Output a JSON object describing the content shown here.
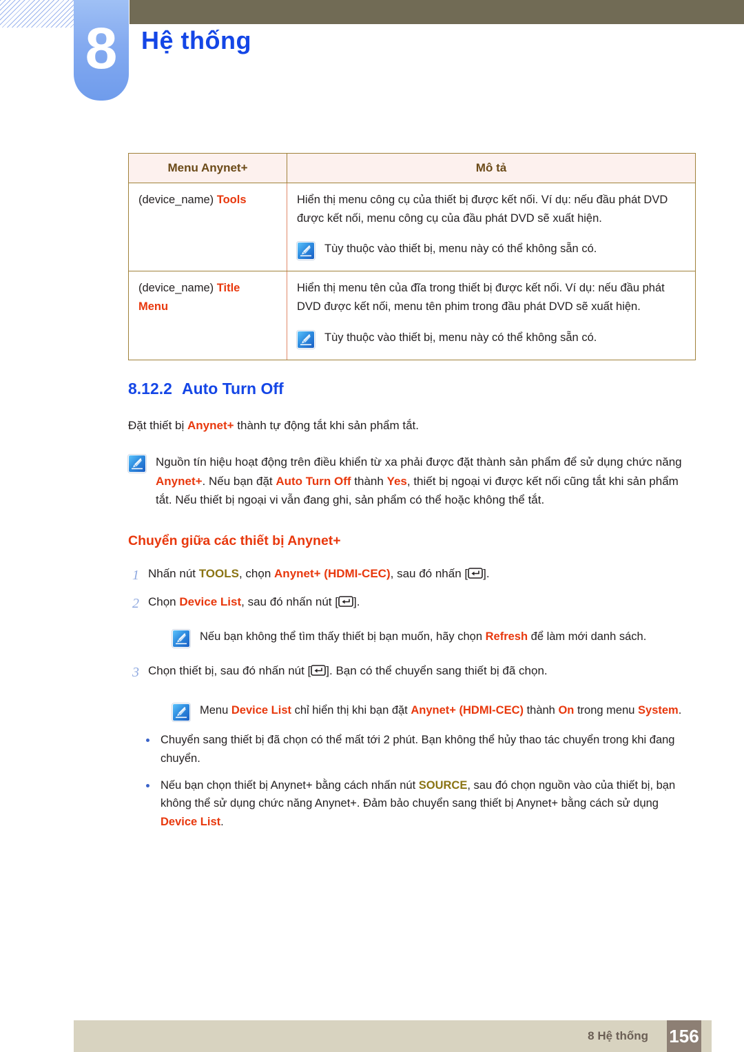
{
  "header": {
    "chapter_number": "8",
    "chapter_title": "Hệ thống"
  },
  "table": {
    "columns": [
      "Menu Anynet+",
      "Mô tả"
    ],
    "rows": [
      {
        "menu_prefix": "(device_name) ",
        "menu_highlight": "Tools",
        "menu_highlight2": "",
        "desc": "Hiển thị menu công cụ của thiết bị được kết nối. Ví dụ: nếu đầu phát DVD được kết nối, menu công cụ của đầu phát DVD sẽ xuất hiện.",
        "note": "Tùy thuộc vào thiết bị, menu này có thể không sẵn có."
      },
      {
        "menu_prefix": "(device_name) ",
        "menu_highlight": "Title",
        "menu_highlight2": "Menu",
        "desc": "Hiển thị menu tên của đĩa trong thiết bị được kết nối. Ví dụ: nếu đầu phát DVD được kết nối, menu tên phim trong đầu phát DVD sẽ xuất hiện.",
        "note": "Tùy thuộc vào thiết bị, menu này có thể không sẵn có."
      }
    ]
  },
  "section": {
    "number": "8.12.2",
    "title": "Auto Turn Off",
    "intro": {
      "part1": "Đặt thiết bị ",
      "hl1": "Anynet+",
      "part2": " thành tự động tắt khi sản phẩm tắt."
    },
    "note": {
      "p1": "Nguồn tín hiệu hoạt động trên điều khiển từ xa phải được đặt thành sản phẩm để sử dụng chức năng ",
      "hl1": "Anynet+",
      "p2": ". Nếu bạn đặt ",
      "hl2": "Auto Turn Off",
      "p3": " thành ",
      "hl3": "Yes",
      "p4": ", thiết bị ngoại vi được kết nối cũng tắt khi sản phẩm tắt. Nếu thiết bị ngoại vi vẫn đang ghi, sản phẩm có thể hoặc không thể tắt."
    }
  },
  "switching": {
    "heading": "Chuyển giữa các thiết bị Anynet+",
    "steps": [
      {
        "num": "1",
        "p1": "Nhấn nút ",
        "hl_olive": "TOOLS",
        "p2": ", chọn ",
        "hl_org": "Anynet+ (HDMI-CEC)",
        "p3": ", sau đó nhấn [",
        "icon": "enter-key-icon",
        "p4": "]."
      },
      {
        "num": "2",
        "p1": "Chọn ",
        "hl_olive": "",
        "p2": "",
        "hl_org": "Device List",
        "p3": ", sau đó nhấn nút [",
        "icon": "enter-key-icon",
        "p4": "]."
      },
      {
        "num": "3",
        "p1": "Chọn thiết bị, sau đó nhấn nút [",
        "hl_olive": "",
        "p2": "",
        "hl_org": "",
        "p3": "",
        "icon": "enter-key-icon",
        "p4": "]. Bạn có thể chuyển sang thiết bị đã chọn."
      }
    ],
    "note_refresh": {
      "p1": "Nếu bạn không thể tìm thấy thiết bị bạn muốn, hãy chọn ",
      "hl1": "Refresh",
      "p2": " để làm mới danh sách."
    },
    "note_devicelist": {
      "p1": "Menu ",
      "hl1": "Device List",
      "p2": " chỉ hiển thị khi bạn đặt ",
      "hl2": "Anynet+ (HDMI-CEC)",
      "p3": " thành ",
      "hl3": "On",
      "p4": " trong menu ",
      "hl4": "System",
      "p5": "."
    },
    "bullets": [
      {
        "p1": "Chuyển sang thiết bị đã chọn có thể mất tới 2 phút. Bạn không thể hủy thao tác chuyển trong khi đang chuyển.",
        "hl_olive": "",
        "p2": "",
        "hl_org": "",
        "p3": ""
      },
      {
        "p1": "Nếu bạn chọn thiết bị Anynet+ bằng cách nhấn nút ",
        "hl_olive": "SOURCE",
        "p2": ", sau đó chọn nguồn vào của thiết bị, bạn không thể sử dụng chức năng Anynet+. Đảm bảo chuyển sang thiết bị Anynet+ bằng cách sử dụng ",
        "hl_org": "Device List",
        "p3": "."
      }
    ]
  },
  "footer": {
    "label": "8 Hệ thống",
    "page_number": "156"
  },
  "colors": {
    "chapter_title": "#1446E6",
    "orange_highlight": "#E8380D",
    "olive_highlight": "#8A7414",
    "khaki_bar": "#716B55",
    "tab_blue": "#84AAF0",
    "footer_bar": "#D8D3C0",
    "footer_pagebox": "#8D7F74",
    "table_header_bg": "#FDF1EE",
    "table_border": "#A0813A"
  }
}
